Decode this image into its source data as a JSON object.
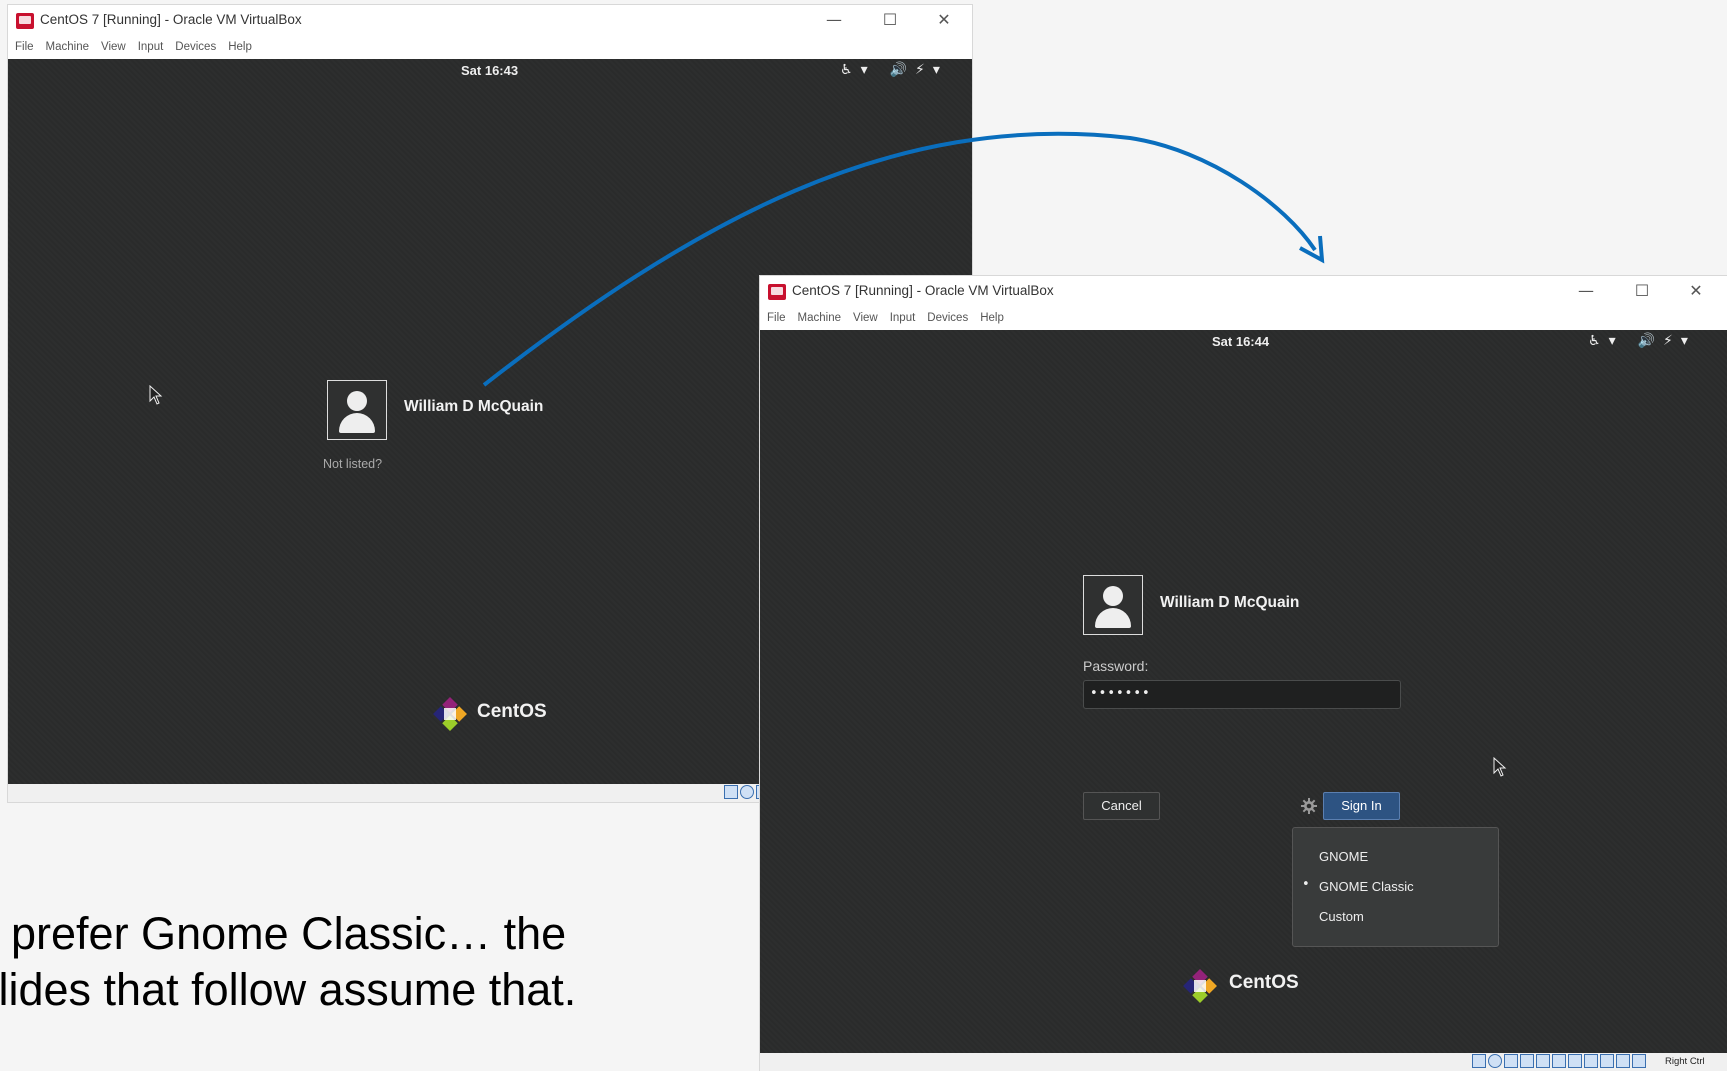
{
  "window1": {
    "title": "CentOS 7 [Running] - Oracle VM VirtualBox",
    "menu": [
      "File",
      "Machine",
      "View",
      "Input",
      "Devices",
      "Help"
    ],
    "controls": {
      "minimize": "—",
      "maximize": "☐",
      "close": "✕"
    },
    "clock": "Sat 16:43",
    "tray": {
      "accessibility": "♿",
      "volume": "🔊",
      "power": "⚡",
      "arrow": "▾"
    },
    "user_name": "William D McQuain",
    "not_listed": "Not listed?",
    "logo_text": "CentOS"
  },
  "window2": {
    "title": "CentOS 7 [Running] - Oracle VM VirtualBox",
    "menu": [
      "File",
      "Machine",
      "View",
      "Input",
      "Devices",
      "Help"
    ],
    "controls": {
      "minimize": "—",
      "maximize": "☐",
      "close": "✕"
    },
    "clock": "Sat 16:44",
    "tray": {
      "accessibility": "♿",
      "volume": "🔊",
      "power": "⚡",
      "arrow": "▾"
    },
    "user_name": "William D McQuain",
    "password_label": "Password:",
    "password_value": "•••••••",
    "cancel_label": "Cancel",
    "signin_label": "Sign In",
    "session_options": [
      "GNOME",
      "GNOME Classic",
      "Custom"
    ],
    "session_selected": "GNOME Classic",
    "bullet": "•",
    "logo_text": "CentOS",
    "host_key": "Right Ctrl"
  },
  "caption": {
    "line1": "I prefer Gnome Classic… the",
    "line2": "slides that follow assume that."
  },
  "colors": {
    "arrow": "#0a6ebd",
    "signin": "#2d5382",
    "desktop": "#2b2c2c"
  }
}
